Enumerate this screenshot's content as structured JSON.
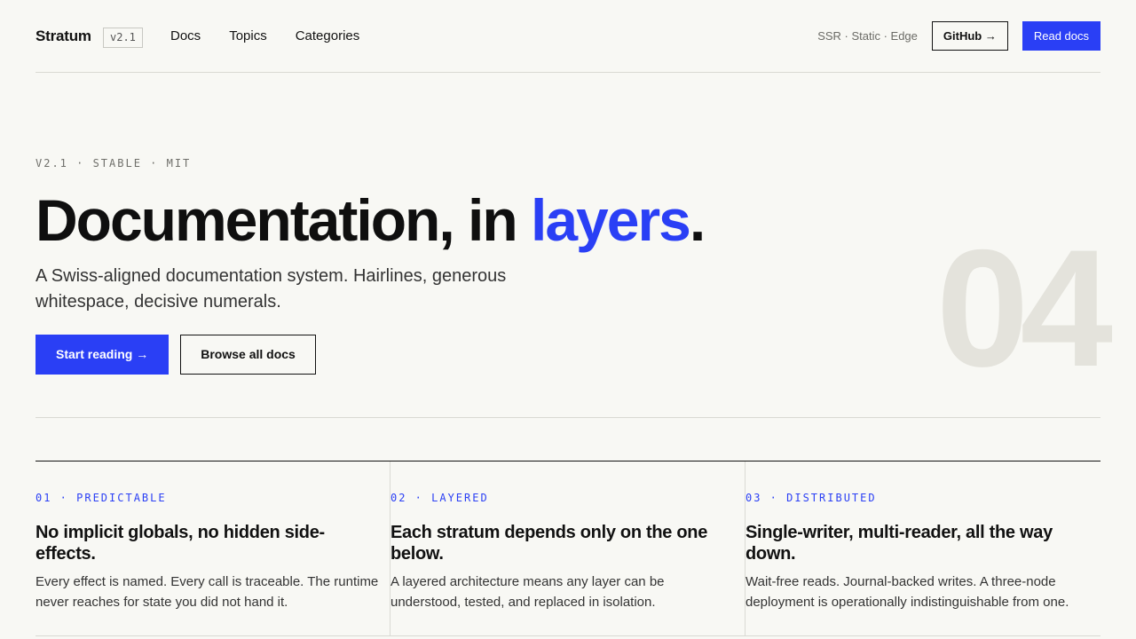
{
  "header": {
    "brand": "Stratum",
    "version": "v2.1",
    "nav": [
      "Docs",
      "Topics",
      "Categories"
    ],
    "modes": "SSR · Static · Edge",
    "github_label": "GitHub →",
    "read_docs_label": "Read docs"
  },
  "hero": {
    "kicker": "V2.1 · STABLE · MIT",
    "title_main": "Documentation, in ",
    "title_accent": "layers",
    "title_end": ".",
    "subtitle": "A Swiss-aligned documentation system. Hairlines, generous whitespace, decisive numerals.",
    "primary_label": "Start reading →",
    "secondary_label": "Browse all docs",
    "numeral": "04"
  },
  "features": [
    {
      "kicker": "01 · PREDICTABLE",
      "title": "No implicit globals, no hidden side-effects.",
      "body": "Every effect is named. Every call is traceable. The runtime never reaches for state you did not hand it."
    },
    {
      "kicker": "02 · LAYERED",
      "title": "Each stratum depends only on the one below.",
      "body": "A layered architecture means any layer can be understood, tested, and replaced in isolation."
    },
    {
      "kicker": "03 · DISTRIBUTED",
      "title": "Single-writer, multi-reader, all the way down.",
      "body": "Wait-free reads. Journal-backed writes. A three-node deployment is operationally indistinguishable from one."
    }
  ],
  "colors": {
    "accent": "#2a3ff5",
    "background": "#f8f8f4",
    "numeral": "#e4e3dc"
  }
}
